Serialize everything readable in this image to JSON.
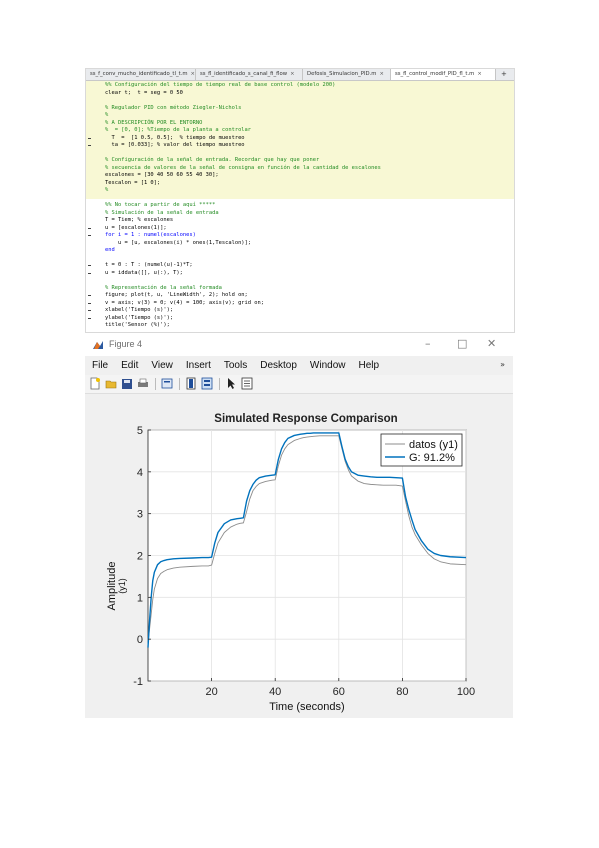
{
  "editor": {
    "tabs": [
      {
        "label": "ss_f_conv_mucho_identificado_tl_t.m",
        "active": false
      },
      {
        "label": "ss_fl_identificado_s_canal_fi_flow",
        "active": false
      },
      {
        "label": "Defosis_Simulacion_PID.m",
        "active": false
      },
      {
        "label": "ss_fl_control_modif_PID_fl_t.m",
        "active": true
      }
    ],
    "tab_add_label": "+",
    "tab_close_label": "×",
    "lines": [
      {
        "text": "%% Configuración del tiempo de tiempo real de base control (modelo 200)",
        "type": "comment"
      },
      {
        "text": "clear t;  t = seg = 0 50",
        "type": "code"
      },
      {
        "text": "",
        "type": "code"
      },
      {
        "text": "% Regulador PID con método Ziegler-Nichols",
        "type": "comment"
      },
      {
        "text": "%",
        "type": "comment"
      },
      {
        "text": "% A DESCRIPCIÓN POR EL ENTORNO",
        "type": "comment"
      },
      {
        "text": "%  = [0, 0]; %Tiempo de la planta a controlar",
        "type": "comment"
      },
      {
        "text": "  T  =  [1 0.5, 0.5];  % tiempo de muestreo",
        "type": "code"
      },
      {
        "text": "  ta = [0.033]; % valor del tiempo muestreo",
        "type": "code"
      },
      {
        "text": "",
        "type": "code"
      },
      {
        "text": "% Configuración de la señal de entrada. Recordar que hay que poner",
        "type": "comment"
      },
      {
        "text": "% secuencia de valores de la señal de consigna en función de la cantidad de escalones",
        "type": "comment"
      },
      {
        "text": "escalones = [30 40 50 60 55 40 30];",
        "type": "code"
      },
      {
        "text": "Tescalon = [1 0];",
        "type": "code"
      },
      {
        "text": "%",
        "type": "comment"
      },
      {
        "text": "",
        "type": "code"
      },
      {
        "text": "%% No tocar a partir de aquí *****",
        "type": "comment"
      },
      {
        "text": "% Simulación de la señal de entrada",
        "type": "comment"
      },
      {
        "text": "T = Tiem; % escalones",
        "type": "code"
      },
      {
        "text": "u = [escalones(1)];",
        "type": "code"
      },
      {
        "text": "for i = 1 : numel(escalones)",
        "type": "keyword"
      },
      {
        "text": "    u = [u, escalones(i) * ones(1,Tescalon)];",
        "type": "code"
      },
      {
        "text": "end",
        "type": "keyword"
      },
      {
        "text": "",
        "type": "code"
      },
      {
        "text": "t = 0 : T : (numel(u)-1)*T;",
        "type": "code"
      },
      {
        "text": "u = iddata([], u(:), T);",
        "type": "code"
      },
      {
        "text": "",
        "type": "code"
      },
      {
        "text": "% Representación de la señal formada",
        "type": "comment"
      },
      {
        "text": "figure; plot(t, u, 'LineWidth', 2); hold on;",
        "type": "code"
      },
      {
        "text": "v = axis; v(3) = 0; v(4) = 100; axis(v); grid on;",
        "type": "code"
      },
      {
        "text": "xlabel('Tiempo (s)');",
        "type": "code"
      },
      {
        "text": "ylabel('Tiempo (s)');",
        "type": "code"
      },
      {
        "text": "title('Sensor (%)');",
        "type": "code"
      }
    ]
  },
  "figure": {
    "title": "Figure 4",
    "controls": {
      "minimize": "–",
      "maximize": "□",
      "close": "✕"
    },
    "menu": [
      "File",
      "Edit",
      "View",
      "Insert",
      "Tools",
      "Desktop",
      "Window",
      "Help"
    ],
    "menu_overflow": "»",
    "toolbar_icons": [
      "new-figure-icon",
      "open-file-icon",
      "save-icon",
      "print-icon",
      "link-plot-icon",
      "insert-colorbar-icon",
      "insert-legend-icon",
      "edit-plot-arrow-icon",
      "property-inspector-icon"
    ]
  },
  "chart_data": {
    "type": "line",
    "title": "Simulated Response Comparison",
    "xlabel": "Time (seconds)",
    "ylabel": "Amplitude",
    "ylabel_sub": "(y1)",
    "xlim": [
      0,
      100
    ],
    "ylim": [
      -1,
      5
    ],
    "xticks": [
      20,
      40,
      60,
      80,
      100
    ],
    "yticks": [
      -1,
      0,
      1,
      2,
      3,
      4,
      5
    ],
    "grid": true,
    "legend_position": "top-right",
    "series": [
      {
        "name": "datos (y1)",
        "color": "#8c8c8c",
        "x": [
          0,
          0.5,
          1,
          1.5,
          2,
          3,
          4,
          5,
          6,
          8,
          10,
          14,
          17,
          18,
          19,
          20,
          21,
          22,
          24,
          26,
          28,
          29,
          30,
          31,
          32,
          33,
          34,
          35,
          37,
          39,
          40,
          41,
          42,
          43,
          44,
          46,
          48,
          49,
          50,
          51,
          52,
          54,
          56,
          58,
          60,
          61,
          62,
          63,
          64,
          66,
          68,
          70,
          72,
          74,
          76,
          78,
          80,
          81,
          82,
          83,
          84,
          86,
          88,
          90,
          92,
          95,
          100
        ],
        "y": [
          -0.05,
          0.25,
          0.6,
          0.95,
          1.2,
          1.45,
          1.57,
          1.62,
          1.66,
          1.7,
          1.72,
          1.74,
          1.75,
          1.75,
          1.75,
          1.77,
          2.05,
          2.3,
          2.55,
          2.68,
          2.75,
          2.77,
          2.78,
          3.05,
          3.35,
          3.55,
          3.65,
          3.72,
          3.77,
          3.8,
          3.81,
          4.15,
          4.4,
          4.55,
          4.65,
          4.75,
          4.8,
          4.82,
          4.83,
          4.84,
          4.85,
          4.86,
          4.86,
          4.86,
          4.86,
          4.55,
          4.25,
          4.05,
          3.9,
          3.78,
          3.72,
          3.7,
          3.69,
          3.68,
          3.68,
          3.68,
          3.66,
          3.3,
          2.95,
          2.68,
          2.5,
          2.25,
          2.05,
          1.92,
          1.85,
          1.8,
          1.78
        ]
      },
      {
        "name": "G: 91.2%",
        "color": "#0072bd",
        "x": [
          0,
          0.5,
          1,
          1.5,
          2,
          3,
          4,
          5,
          6,
          8,
          10,
          14,
          17,
          18,
          19,
          20,
          21,
          22,
          24,
          26,
          28,
          29,
          30,
          31,
          32,
          33,
          34,
          35,
          37,
          39,
          40,
          41,
          42,
          43,
          44,
          46,
          48,
          49,
          50,
          51,
          52,
          54,
          56,
          58,
          60,
          61,
          62,
          63,
          64,
          66,
          68,
          70,
          72,
          74,
          76,
          78,
          80,
          81,
          82,
          83,
          84,
          86,
          88,
          90,
          92,
          95,
          100
        ],
        "y": [
          -0.2,
          0.45,
          1.0,
          1.4,
          1.6,
          1.78,
          1.85,
          1.88,
          1.9,
          1.92,
          1.93,
          1.94,
          1.95,
          1.95,
          1.95,
          1.96,
          2.3,
          2.55,
          2.76,
          2.85,
          2.88,
          2.89,
          2.9,
          3.3,
          3.55,
          3.7,
          3.8,
          3.86,
          3.9,
          3.92,
          3.93,
          4.3,
          4.55,
          4.7,
          4.8,
          4.87,
          4.9,
          4.91,
          4.92,
          4.92,
          4.93,
          4.93,
          4.93,
          4.93,
          4.93,
          4.6,
          4.3,
          4.12,
          4.0,
          3.92,
          3.9,
          3.88,
          3.87,
          3.87,
          3.87,
          3.86,
          3.85,
          3.4,
          3.1,
          2.85,
          2.62,
          2.35,
          2.15,
          2.05,
          2.0,
          1.97,
          1.95
        ]
      }
    ]
  }
}
